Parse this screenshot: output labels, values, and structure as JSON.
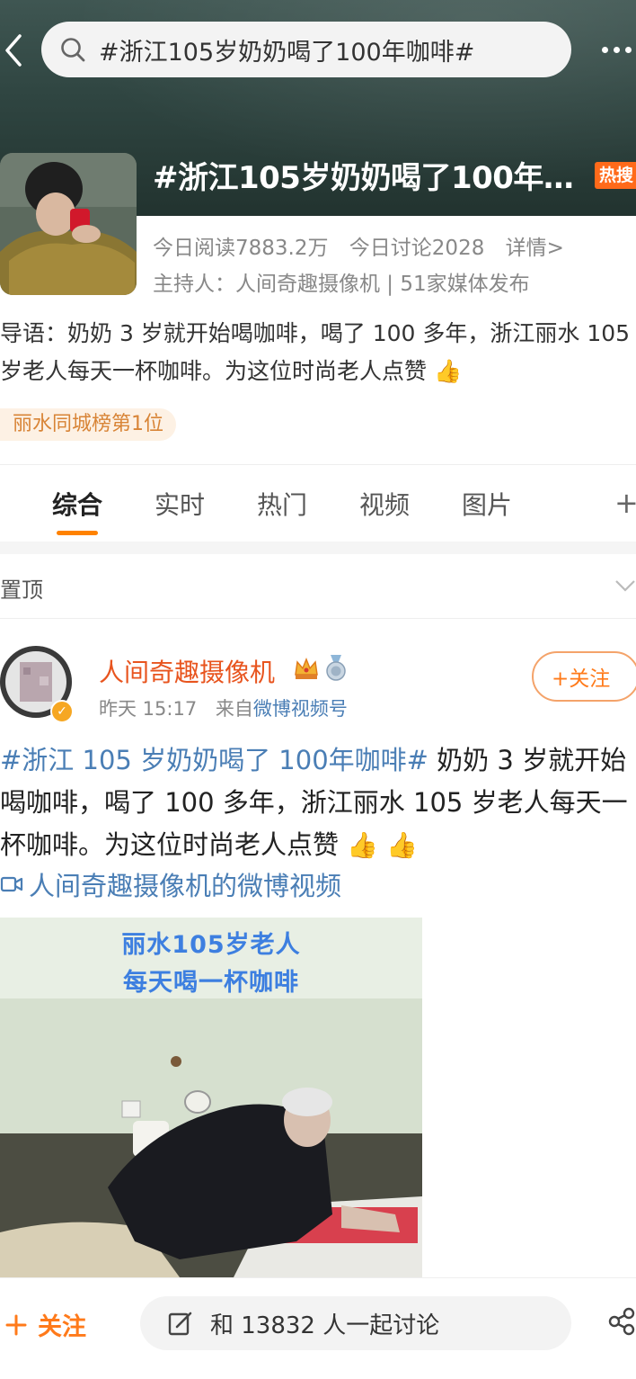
{
  "search": {
    "query": "#浙江105岁奶奶喝了100年咖啡#"
  },
  "topic": {
    "title": "#浙江105岁奶奶喝了100年…",
    "hot_badge": "热搜",
    "reads": "今日阅读7883.2万",
    "discussions": "今日讨论2028",
    "details": "详情>",
    "host": "主持人：人间奇趣摄像机 | 51家媒体发布",
    "intro": "导语：奶奶 3 岁就开始喝咖啡，喝了 100 多年，浙江丽水 105 岁老人每天一杯咖啡。为这位时尚老人点赞 👍",
    "rank_tag": "丽水同城榜第1位"
  },
  "tabs": [
    "综合",
    "实时",
    "热门",
    "视频",
    "图片"
  ],
  "tab_add": "+",
  "pinned": {
    "label": "置顶"
  },
  "post": {
    "author": "人间奇趣摄像机",
    "time": "昨天 15:17",
    "source_prefix": "来自",
    "source": "微博视频号",
    "follow": "+关注",
    "hashtag": "#浙江 105 岁奶奶喝了 100年咖啡#",
    "body": " 奶奶 3 岁就开始喝咖啡，喝了 100 多年，浙江丽水 105 岁老人每天一杯咖啡。为这位时尚老人点赞 ",
    "thumbs": "👍 👍",
    "video_link": "人间奇趣摄像机的微博视频",
    "video_caption_1": "丽水105岁老人",
    "video_caption_2": "每天喝一杯咖啡"
  },
  "bottom": {
    "follow": "关注",
    "discuss": "和 13832 人一起讨论"
  },
  "colors": {
    "accent": "#ff8200",
    "link": "#4a7eb5",
    "author": "#e8541e",
    "hot": "#ff6a1a"
  },
  "icons": [
    "back-icon",
    "search-icon",
    "more-icon",
    "crown-icon",
    "medal-icon",
    "verified-icon",
    "video-icon",
    "chevron-down-icon",
    "plus-icon",
    "edit-icon",
    "share-icon"
  ]
}
